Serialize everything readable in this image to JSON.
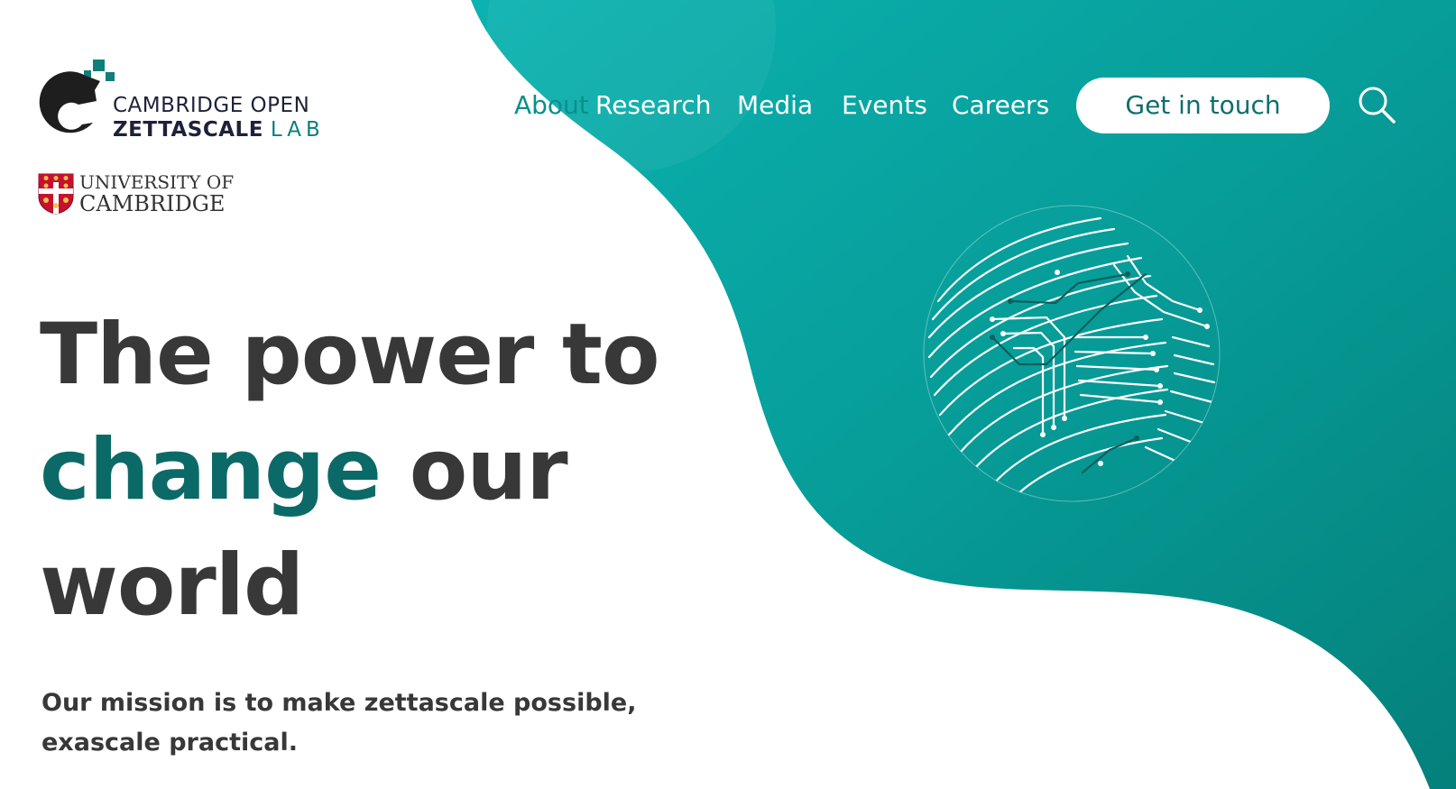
{
  "logo": {
    "line1": "CAMBRIDGE OPEN",
    "line2": "ZETTASCALE",
    "line2_accent": "LAB"
  },
  "university": {
    "line1": "UNIVERSITY OF",
    "line2": "CAMBRIDGE"
  },
  "nav": {
    "items": [
      {
        "label": "About"
      },
      {
        "label": "Research"
      },
      {
        "label": "Media"
      },
      {
        "label": "Events"
      },
      {
        "label": "Careers"
      }
    ],
    "cta": "Get in touch",
    "search_icon": "search-icon"
  },
  "hero": {
    "title_part1": "The power to",
    "title_highlight": "change",
    "title_part2": "our",
    "title_part3": "world",
    "mission": "Our mission is to make zettascale possible, exascale practical."
  },
  "colors": {
    "teal": "#08a8a6",
    "teal_dark": "#06827e",
    "heading": "#383838",
    "accent": "#0b6a67",
    "logo_navy": "#1d2238"
  },
  "illustration": "circuit-globe-icon"
}
